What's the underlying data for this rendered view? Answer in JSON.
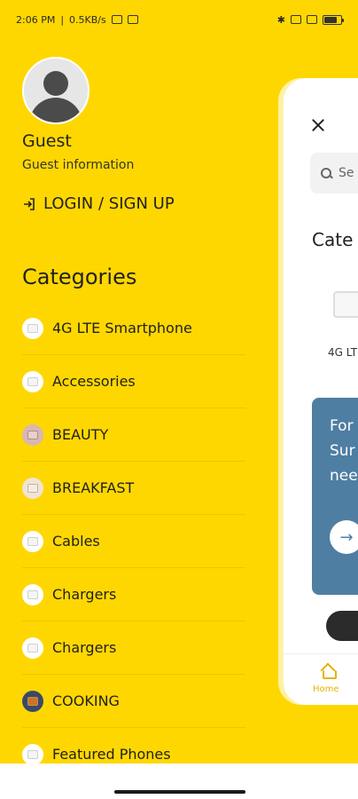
{
  "status_bar": {
    "time": "2:06 PM",
    "network_speed": "0.5KB/s",
    "battery_level": 0.7
  },
  "drawer": {
    "user_name": "Guest",
    "user_subtitle": "Guest information",
    "login_label": "LOGIN / SIGN UP",
    "categories_title": "Categories",
    "categories": [
      {
        "label": "4G LTE Smartphone",
        "icon": "placeholder-image-icon"
      },
      {
        "label": "Accessories",
        "icon": "placeholder-image-icon"
      },
      {
        "label": "BEAUTY",
        "icon": "category-photo-icon"
      },
      {
        "label": "BREAKFAST",
        "icon": "category-photo-icon"
      },
      {
        "label": "Cables",
        "icon": "placeholder-image-icon"
      },
      {
        "label": "Chargers",
        "icon": "placeholder-image-icon"
      },
      {
        "label": "Chargers",
        "icon": "placeholder-image-icon"
      },
      {
        "label": "COOKING",
        "icon": "category-photo-icon"
      },
      {
        "label": "Featured Phones",
        "icon": "placeholder-image-icon"
      }
    ]
  },
  "preview": {
    "search_placeholder": "Se",
    "category_title": "Cate",
    "category_item_label": "4G LT",
    "banner_text_line1": "For",
    "banner_text_line2": "Sur",
    "banner_text_line3": "nee",
    "nav_home_label": "Home",
    "accent_color": "#E7B200",
    "banner_color": "#4F7EA3"
  },
  "colors": {
    "drawer_background": "#FFD700"
  }
}
